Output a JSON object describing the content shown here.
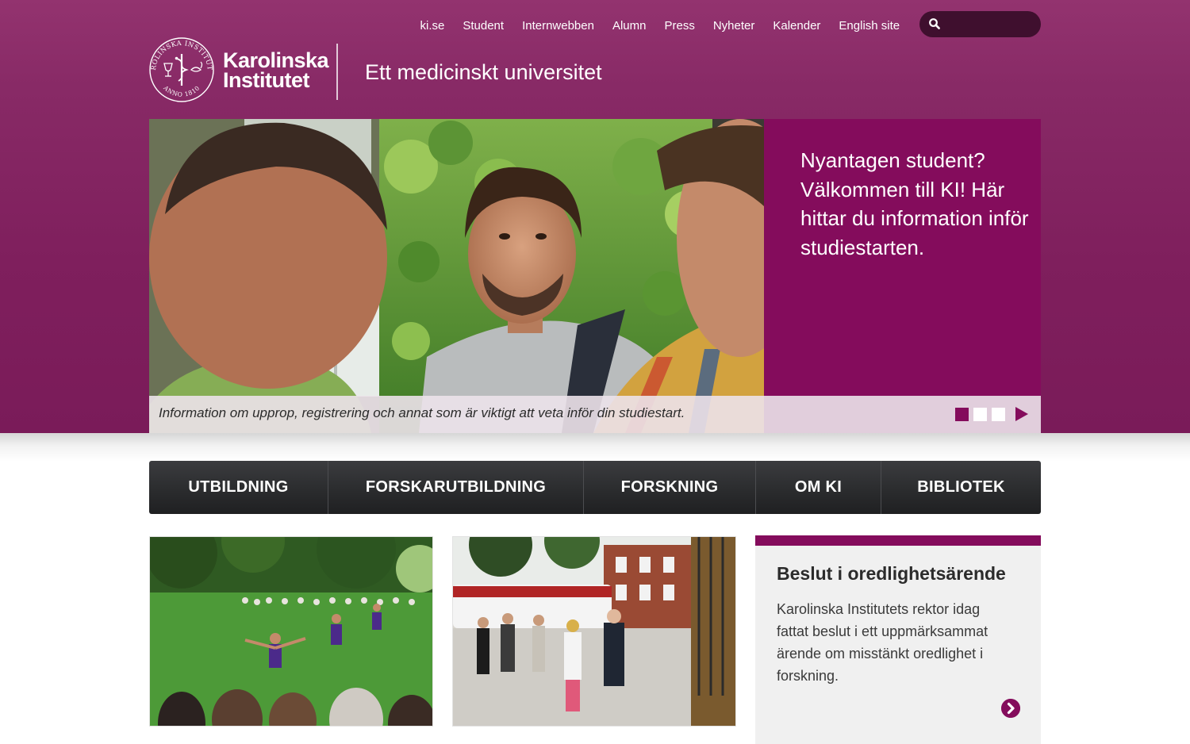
{
  "colors": {
    "brand": "#840c5c",
    "header_bg": "#7f1f5d",
    "search_bg": "#3f0f2e",
    "nav_bg": "#2b2c2e",
    "card_bg": "#f0f0f0"
  },
  "topnav": {
    "links": [
      {
        "label": "ki.se"
      },
      {
        "label": "Student"
      },
      {
        "label": "Internwebben"
      },
      {
        "label": "Alumn"
      },
      {
        "label": "Press"
      },
      {
        "label": "Nyheter"
      },
      {
        "label": "Kalender"
      },
      {
        "label": "English site"
      }
    ],
    "search": {
      "placeholder": "",
      "icon": "search-icon"
    }
  },
  "logo": {
    "line1": "Karolinska",
    "line2": "Institutet",
    "seal_text_top": "KAROLINSKA INSTITUTET",
    "seal_text_bottom": "ANNO 1810"
  },
  "tagline": "Ett medicinskt universitet",
  "hero": {
    "headline": "Nyantagen student? Välkommen till KI! Här hittar du information inför studiestarten.",
    "caption": "Information om upprop, registrering och annat som är viktigt att veta inför din studiestart.",
    "slides": 3,
    "active_slide": 1,
    "next_icon": "play-arrow-icon"
  },
  "mainnav": {
    "items": [
      {
        "label": "UTBILDNING"
      },
      {
        "label": "FORSKARUTBILDNING"
      },
      {
        "label": "FORSKNING"
      },
      {
        "label": "OM KI"
      },
      {
        "label": "BIBLIOTEK"
      }
    ]
  },
  "news": {
    "title": "Beslut i oredlighetsärende",
    "body": "Karolinska Institutets rektor idag fattat beslut i ett uppmärksammat ärende om misstänkt oredlighet i forskning.",
    "arrow_icon": "chevron-right-circle-icon"
  }
}
